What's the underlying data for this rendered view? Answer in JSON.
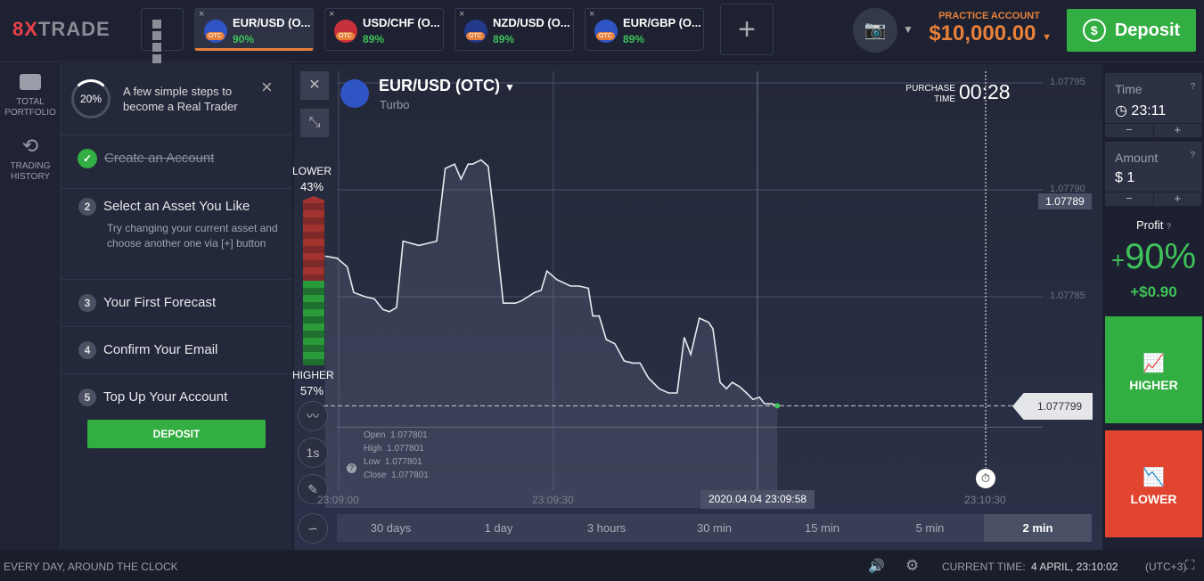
{
  "header": {
    "logo": "8XTRADE",
    "logo_accent": "8X",
    "logo_rest": "TRADE",
    "tabs": [
      {
        "name": "EUR/USD (O...",
        "payout": "90%",
        "otc": "OTC"
      },
      {
        "name": "USD/CHF (O...",
        "payout": "89%",
        "otc": "OTC"
      },
      {
        "name": "NZD/USD (O...",
        "payout": "89%",
        "otc": "OTC"
      },
      {
        "name": "EUR/GBP (O...",
        "payout": "89%",
        "otc": "OTC"
      }
    ],
    "close": "×",
    "add": "+",
    "account_label": "PRACTICE ACCOUNT",
    "balance": "$10,000.00",
    "deposit": "Deposit"
  },
  "sidebar": [
    {
      "label": "TOTAL PORTFOLIO"
    },
    {
      "label": "TRADING HISTORY"
    }
  ],
  "onboarding": {
    "progress": "20%",
    "progress_value": 20,
    "title": "A few simple steps to become a Real Trader",
    "close": "×",
    "steps": [
      {
        "num": "✓",
        "label": "Create an Account",
        "done": true
      },
      {
        "num": "2",
        "label": "Select an Asset You Like",
        "sub": "Try changing your current asset and choose another one via [+] button"
      },
      {
        "num": "3",
        "label": "Your First Forecast"
      },
      {
        "num": "4",
        "label": "Confirm Your Email"
      },
      {
        "num": "5",
        "label": "Top Up Your Account"
      }
    ],
    "deposit": "DEPOSIT"
  },
  "chart": {
    "asset": "EUR/USD (OTC)",
    "type": "Turbo",
    "purchase_label1": "PURCHASE",
    "purchase_label2": "TIME",
    "purchase_time": "00:28",
    "lower_label": "LOWER",
    "lower_pct": "43%",
    "higher_label": "HIGHER",
    "higher_pct": "57%",
    "y_ticks": [
      "1.07795",
      "1.07790",
      "1.07785"
    ],
    "crosshair_price": "1.07789",
    "current_price": "1.077799",
    "x_ticks": [
      "23:09:00",
      "23:09:30",
      "23:10:30"
    ],
    "crosshair_time": "2020.04.04 23:09:58",
    "ohlc": [
      [
        "Open",
        "1.077801"
      ],
      [
        "High",
        "1.077801"
      ],
      [
        "Low",
        "1.077801"
      ],
      [
        "Close",
        "1.077801"
      ]
    ],
    "tool_1s": "1s",
    "timeframes": [
      "30 days",
      "1 day",
      "3 hours",
      "30 min",
      "15 min",
      "5 min",
      "2 min"
    ],
    "active_timeframe": "2 min",
    "series": [
      [
        -1.9,
        1.077869
      ],
      [
        -0.2,
        1.077868
      ],
      [
        1.2,
        1.077864
      ],
      [
        2.1,
        1.077852
      ],
      [
        3.7,
        1.07785
      ],
      [
        5,
        1.077849
      ],
      [
        6.2,
        1.077844
      ],
      [
        7.1,
        1.077843
      ],
      [
        8.1,
        1.077845
      ],
      [
        9,
        1.077876
      ],
      [
        11.2,
        1.077874
      ],
      [
        12.5,
        1.077875
      ],
      [
        13.7,
        1.077876
      ],
      [
        14.9,
        1.07791
      ],
      [
        16.2,
        1.077912
      ],
      [
        17.1,
        1.077905
      ],
      [
        18.1,
        1.077912
      ],
      [
        18.7,
        1.077912
      ],
      [
        19.9,
        1.077914
      ],
      [
        20.9,
        1.077911
      ],
      [
        21.8,
        1.077885
      ],
      [
        23,
        1.077847
      ],
      [
        24.7,
        1.077847
      ],
      [
        25.5,
        1.077848
      ],
      [
        27.4,
        1.077852
      ],
      [
        28.3,
        1.077853
      ],
      [
        29.1,
        1.077862
      ],
      [
        30.5,
        1.077858
      ],
      [
        32.4,
        1.077855
      ],
      [
        33.6,
        1.077855
      ],
      [
        34.9,
        1.077854
      ],
      [
        35.5,
        1.077841
      ],
      [
        36.4,
        1.077841
      ],
      [
        37.4,
        1.07783
      ],
      [
        38.6,
        1.077828
      ],
      [
        39.9,
        1.07782
      ],
      [
        41.1,
        1.077819
      ],
      [
        42.1,
        1.077819
      ],
      [
        43.3,
        1.077812
      ],
      [
        44.8,
        1.077807
      ],
      [
        46.1,
        1.077805
      ],
      [
        47.3,
        1.077805
      ],
      [
        48.3,
        1.077831
      ],
      [
        49.2,
        1.077823
      ],
      [
        50.4,
        1.07784
      ],
      [
        51.7,
        1.077838
      ],
      [
        52.3,
        1.077835
      ],
      [
        53.3,
        1.07781
      ],
      [
        54.2,
        1.077807
      ],
      [
        55,
        1.07781
      ],
      [
        56,
        1.077808
      ],
      [
        57,
        1.077805
      ],
      [
        57.9,
        1.077802
      ],
      [
        58.8,
        1.077803
      ],
      [
        59.5,
        1.0778
      ],
      [
        60.5,
        1.0778
      ],
      [
        61.3,
        1.077799
      ]
    ]
  },
  "trade": {
    "time_label": "Time",
    "time_value": "23:11",
    "amount_label": "Amount",
    "amount_value": "$ 1",
    "minus": "−",
    "plus": "+",
    "help": "?",
    "profit_label": "Profit",
    "profit_pct": "+90%",
    "profit_sign": "+",
    "profit_num": "90",
    "profit_unit": "%",
    "profit_amount": "+$0.90",
    "higher": "HIGHER",
    "lower": "LOWER"
  },
  "footer": {
    "tagline": "EVERY DAY, AROUND THE CLOCK",
    "current_time_label": "CURRENT TIME:",
    "current_time": "4 APRIL, 23:10:02",
    "tz": "(UTC+3)"
  },
  "colors": {
    "green": "#32ae42",
    "red": "#e2452f",
    "orange": "#e8803a"
  }
}
